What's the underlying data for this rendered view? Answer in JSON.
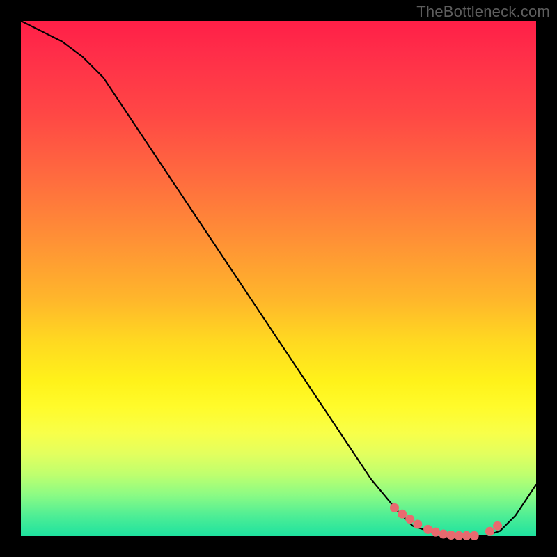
{
  "watermark": "TheBottleneck.com",
  "chart_data": {
    "type": "line",
    "title": "",
    "xlabel": "",
    "ylabel": "",
    "xlim": [
      0,
      100
    ],
    "ylim": [
      0,
      100
    ],
    "grid": false,
    "legend": false,
    "annotations": [],
    "series": [
      {
        "name": "curve",
        "x": [
          0,
          4,
          8,
          12,
          16,
          20,
          26,
          32,
          38,
          44,
          50,
          56,
          62,
          68,
          73,
          76,
          79,
          82,
          85,
          88,
          90,
          93,
          96,
          100
        ],
        "y": [
          100,
          98,
          96,
          93,
          89,
          83,
          74,
          65,
          56,
          47,
          38,
          29,
          20,
          11,
          5,
          2,
          1,
          0,
          0,
          0,
          0,
          1,
          4,
          10
        ]
      },
      {
        "name": "markers",
        "x": [
          72.5,
          74,
          75.5,
          77,
          79,
          80.5,
          82,
          83.5,
          85,
          86.5,
          88,
          91,
          92.5
        ],
        "y": [
          5.5,
          4.3,
          3.3,
          2.3,
          1.3,
          0.8,
          0.4,
          0.2,
          0.1,
          0.1,
          0.1,
          0.9,
          2.0
        ]
      }
    ],
    "gradient_stops": [
      {
        "pos": 0,
        "color": "#ff1f47"
      },
      {
        "pos": 18,
        "color": "#ff4745"
      },
      {
        "pos": 42,
        "color": "#ff8f36"
      },
      {
        "pos": 62,
        "color": "#ffd821"
      },
      {
        "pos": 80,
        "color": "#f8ff49"
      },
      {
        "pos": 92,
        "color": "#8cfb84"
      },
      {
        "pos": 100,
        "color": "#1ee29f"
      }
    ]
  }
}
